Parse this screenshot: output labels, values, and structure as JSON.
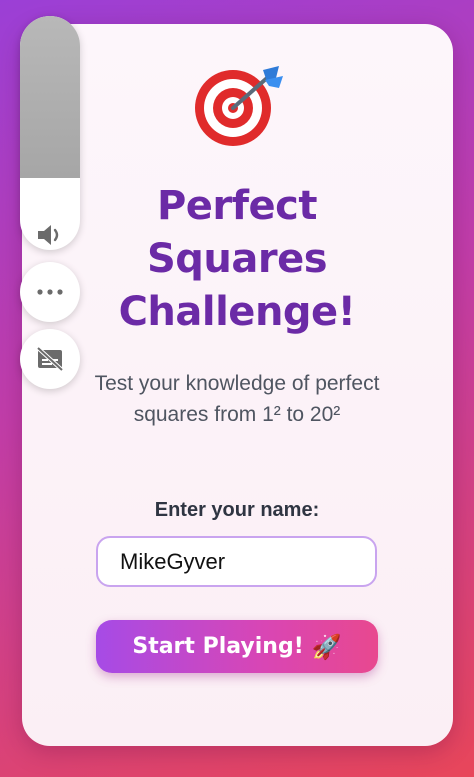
{
  "hero": {
    "icon": "target-dart-icon",
    "title": "Perfect Squares Challenge!",
    "subtitle": "Test your knowledge of perfect squares from 1² to 20²"
  },
  "form": {
    "name_label": "Enter your name:",
    "name_value": "MikeGyver"
  },
  "start_button": {
    "label": "Start Playing!",
    "icon": "rocket-icon",
    "rocket_glyph": "🚀"
  },
  "side_controls": {
    "volume_icon": "speaker-icon",
    "more_icon": "more-dots-icon",
    "captions_icon": "captions-off-icon",
    "volume_level": 0.7
  },
  "colors": {
    "title": "#6b2aa6",
    "button_start": "#a64be6",
    "button_end": "#e8488f",
    "input_border": "#c9a4ef",
    "background_start": "#9b3fd6",
    "background_end": "#e8465a"
  }
}
